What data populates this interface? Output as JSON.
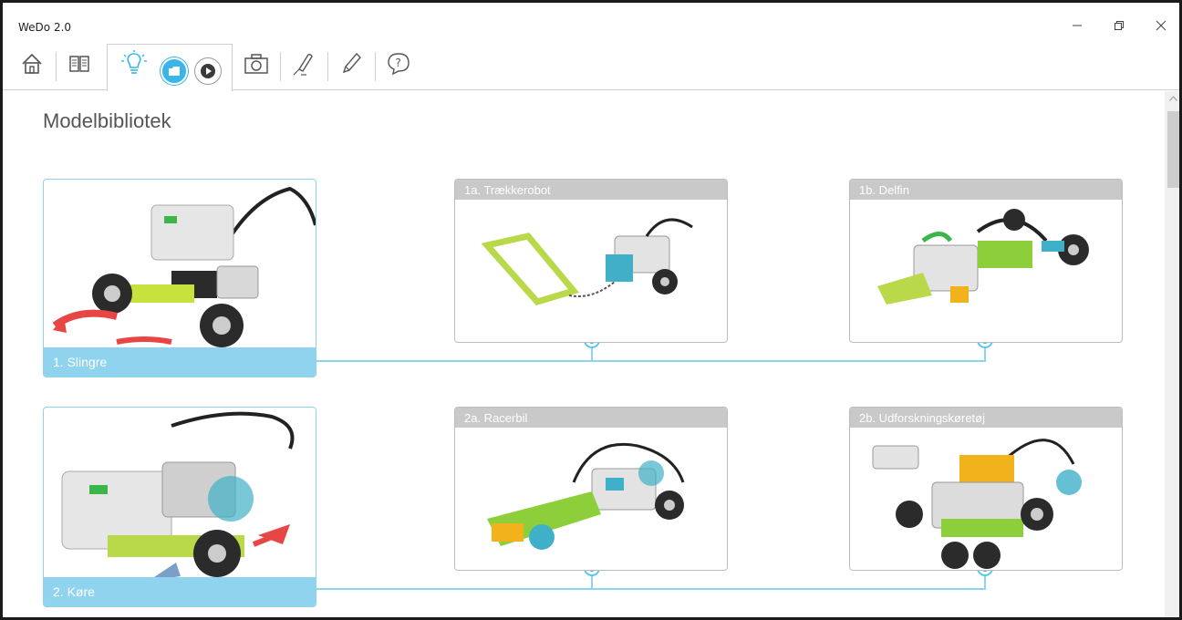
{
  "window": {
    "title": "WeDo 2.0"
  },
  "page": {
    "title": "Modelbibliotek"
  },
  "toolbar": {
    "items": [
      "home-icon",
      "book-icon",
      "lightbulb-icon",
      "library-icon",
      "video-icon",
      "camera-icon",
      "marker-icon",
      "pencil-icon",
      "help-icon"
    ]
  },
  "models": {
    "row1": {
      "main": "1. Slingre",
      "a": "1a. Trækkerobot",
      "b": "1b. Delfin"
    },
    "row2": {
      "main": "2. Køre",
      "a": "2a. Racerbil",
      "b": "2b. Udforskningskøretøj"
    }
  },
  "colors": {
    "accent": "#8fd3ee",
    "node": "#3ab5e8",
    "header_gray": "#c9c9c9"
  }
}
